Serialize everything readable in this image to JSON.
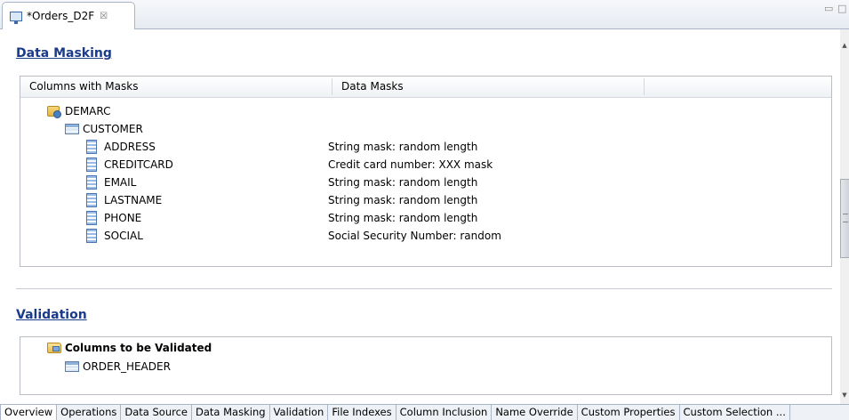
{
  "editor": {
    "tab_title": "*Orders_D2F",
    "close_symbol": "☒",
    "minimize_symbol": "▭",
    "maximize_symbol": "□"
  },
  "data_masking": {
    "title": "Data Masking",
    "columns": [
      "Columns with Masks",
      "Data Masks",
      ""
    ],
    "tree": {
      "database": "DEMARC",
      "table": "CUSTOMER",
      "rows": [
        {
          "column": "ADDRESS",
          "mask": "String mask: random length"
        },
        {
          "column": "CREDITCARD",
          "mask": "Credit card number: XXX mask"
        },
        {
          "column": "EMAIL",
          "mask": "String mask: random length"
        },
        {
          "column": "LASTNAME",
          "mask": "String mask: random length"
        },
        {
          "column": "PHONE",
          "mask": "String mask: random length"
        },
        {
          "column": "SOCIAL",
          "mask": "Social Security Number: random"
        }
      ]
    }
  },
  "validation": {
    "title": "Validation",
    "group_label": "Columns to be Validated",
    "items": [
      "ORDER_HEADER"
    ]
  },
  "bottom_tabs": [
    "Overview",
    "Operations",
    "Data Source",
    "Data Masking",
    "Validation",
    "File Indexes",
    "Column Inclusion",
    "Name Override",
    "Custom Properties",
    "Custom Selection ..."
  ],
  "active_bottom_tab": "Overview",
  "scroll_glyphs": {
    "up": "▲",
    "down": "▼"
  }
}
